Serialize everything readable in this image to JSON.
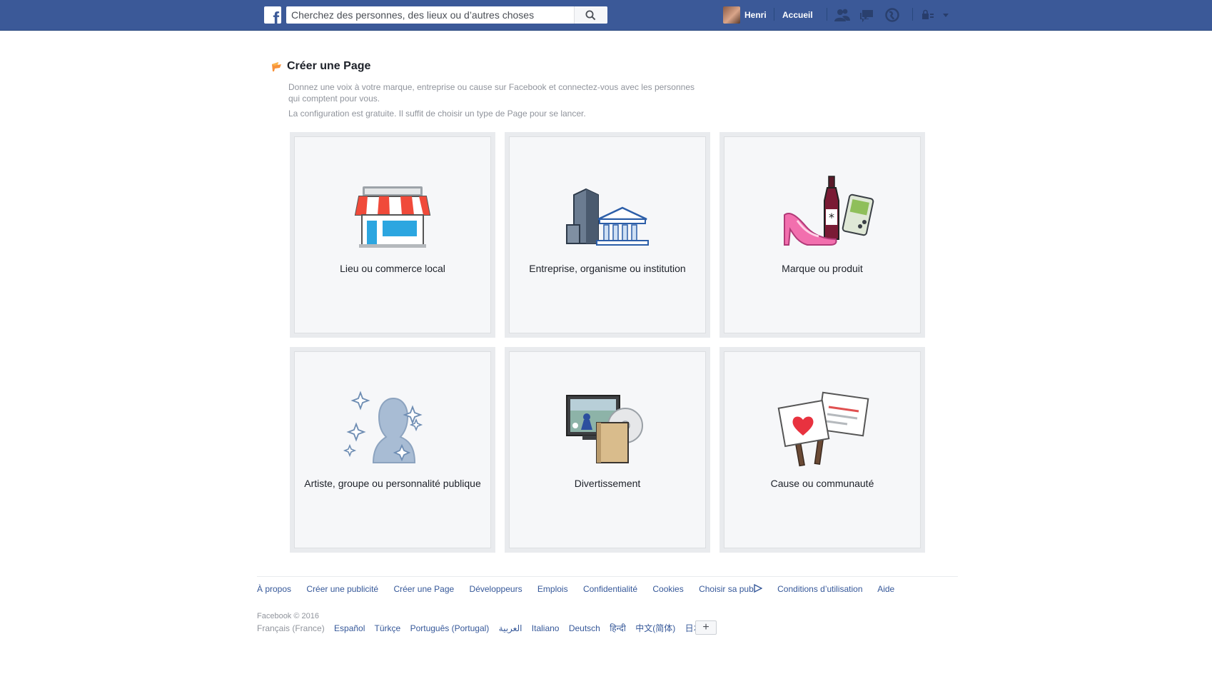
{
  "topbar": {
    "logo": "f",
    "search_placeholder": "Cherchez des personnes, des lieux ou d’autres choses",
    "user_name": "Henri",
    "home_label": "Accueil"
  },
  "header": {
    "title": "Créer une Page",
    "description": "Donnez une voix à votre marque, entreprise ou cause sur Facebook et connectez-vous avec les personnes qui comptent pour vous.",
    "note": "La configuration est gratuite. Il suffit de choisir un type de Page pour se lancer."
  },
  "tiles": [
    {
      "label": "Lieu ou commerce local",
      "icon": "storefront-icon"
    },
    {
      "label": "Entreprise, organisme ou institution",
      "icon": "building-icon"
    },
    {
      "label": "Marque ou produit",
      "icon": "products-icon"
    },
    {
      "label": "Artiste, groupe ou personnalité publique",
      "icon": "public-figure-icon"
    },
    {
      "label": "Divertissement",
      "icon": "entertainment-icon"
    },
    {
      "label": "Cause ou communauté",
      "icon": "cause-signs-icon"
    }
  ],
  "footer": {
    "links": [
      "À propos",
      "Créer une publicité",
      "Créer une Page",
      "Développeurs",
      "Emplois",
      "Confidentialité",
      "Cookies",
      "Choisir sa pub",
      "Conditions d’utilisation",
      "Aide"
    ],
    "copyright": "Facebook © 2016",
    "current_language": "Français (France)",
    "languages": [
      "Español",
      "Türkçe",
      "Português (Portugal)",
      "العربية",
      "Italiano",
      "Deutsch",
      "हिन्दी",
      "中文(简体)",
      "日本語"
    ],
    "more_languages": "+"
  },
  "colors": {
    "brand": "#3b5998",
    "link": "#365899",
    "tile_bg": "#f6f7f9",
    "tile_border": "#e9ebee"
  }
}
